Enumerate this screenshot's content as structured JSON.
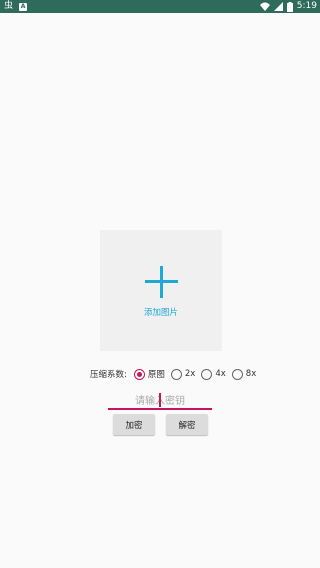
{
  "status_bar": {
    "left_icons": [
      "虫",
      "A"
    ],
    "time": "5:19",
    "icons": [
      "wifi-icon",
      "signal-icon",
      "battery-icon"
    ]
  },
  "image_picker": {
    "label": "添加图片",
    "icon": "plus-icon"
  },
  "compression": {
    "label": "压缩系数:",
    "options": [
      "原图",
      "2x",
      "4x",
      "8x"
    ],
    "selected": "原图"
  },
  "key_input": {
    "placeholder": "请输入密钥",
    "value": ""
  },
  "buttons": {
    "encrypt": "加密",
    "decrypt": "解密"
  },
  "colors": {
    "status_bar": "#2f6b5a",
    "accent": "#c2185b",
    "plus": "#1fa7d6"
  }
}
